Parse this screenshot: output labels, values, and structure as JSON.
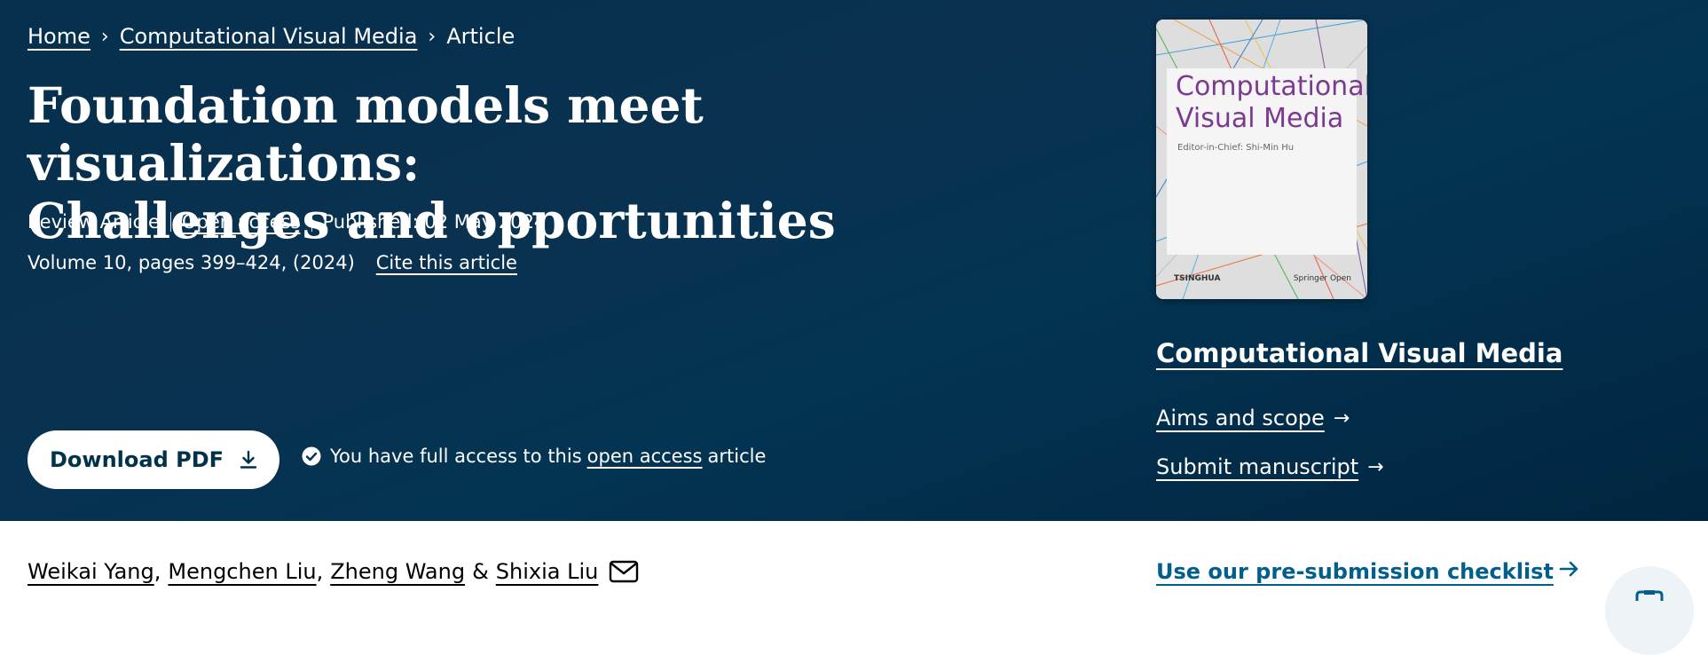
{
  "breadcrumb": {
    "home": "Home",
    "journal": "Computational Visual Media",
    "current": "Article"
  },
  "article": {
    "title_line1": "Foundation models meet visualizations:",
    "title_line2": "Challenges and opportunities",
    "type": "Review Article",
    "open_access": "Open access",
    "published": "Published: 02 May 2024",
    "volume": "Volume 10, pages 399–424, (2024)",
    "cite": "Cite this article"
  },
  "actions": {
    "download_pdf": "Download PDF",
    "access_prefix": "You have full access to this",
    "access_link": "open access",
    "access_suffix": "article"
  },
  "cover": {
    "title_line1": "Computational",
    "title_line2": "Visual Media",
    "editor": "Editor-in-Chief: Shi-Min Hu",
    "publisher_left": "TSINGHUA",
    "publisher_right": "Springer Open"
  },
  "sidebar": {
    "journal": "Computational Visual Media",
    "aims": "Aims and scope",
    "submit": "Submit manuscript",
    "checklist": "Use our pre-submission checklist"
  },
  "authors": {
    "a1": "Weikai Yang",
    "a2": "Mengchen Liu",
    "a3": "Zheng Wang",
    "amp": "&",
    "a4": "Shixia Liu"
  },
  "colors": {
    "hero_bg": "#04304d",
    "button_text": "#01324b",
    "link_blue": "#025e8d",
    "cover_title": "#7b3a90"
  },
  "icons": {
    "download": "download-icon",
    "check": "check-circle-icon",
    "arrow": "arrow-right-icon",
    "mail": "mail-icon",
    "cart": "cart-icon",
    "chevron": "chevron-right-icon"
  }
}
